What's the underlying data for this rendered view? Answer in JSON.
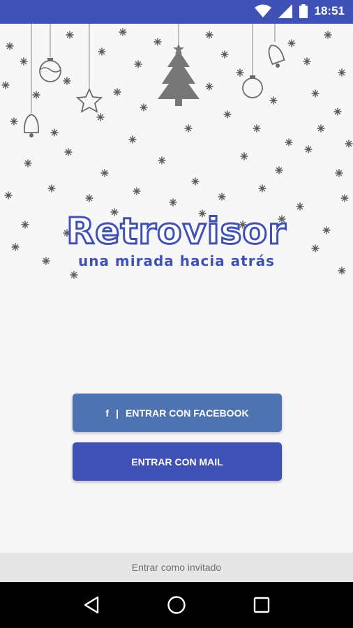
{
  "status_bar": {
    "time": "18:51",
    "icons": [
      "wifi-icon",
      "signal-icon",
      "battery-icon"
    ],
    "color": "#3f51b5"
  },
  "logo": {
    "title": "Retrovisor",
    "subtitle": "una mirada hacia atrás",
    "color": "#3f51b5"
  },
  "buttons": {
    "facebook": {
      "icon": "f",
      "separator": "|",
      "label": "ENTRAR CON FACEBOOK",
      "color": "#4f73b0"
    },
    "mail": {
      "label": "ENTRAR CON MAIL",
      "color": "#3f51b5"
    }
  },
  "guest": {
    "label": "Entrar como invitado"
  },
  "nav": {
    "icons": [
      "back-icon",
      "home-icon",
      "recents-icon"
    ]
  }
}
